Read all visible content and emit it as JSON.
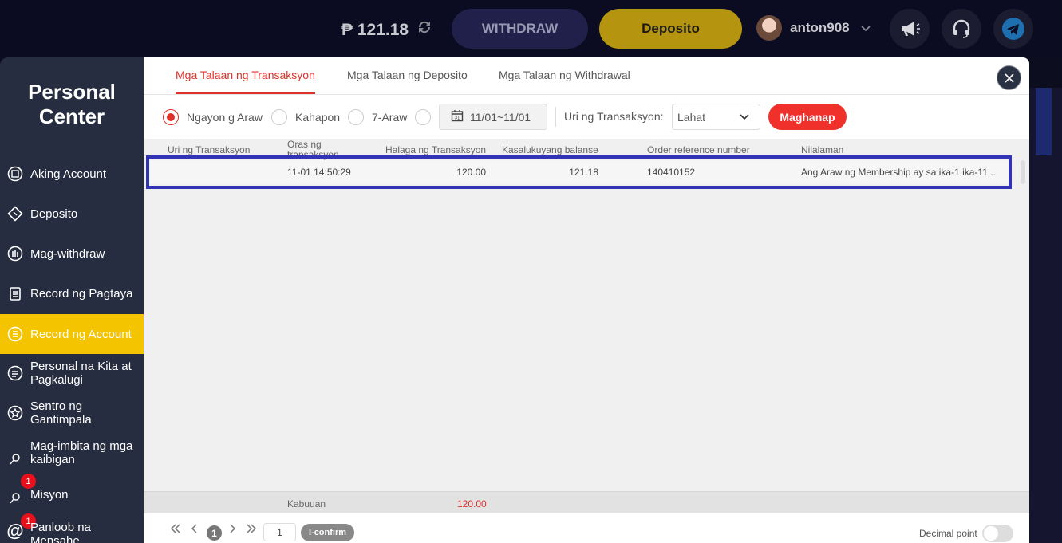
{
  "topbar": {
    "balance": "₱ 121.18",
    "withdraw_label": "WITHDRAW",
    "deposit_label": "Deposito",
    "username": "anton908",
    "icons": [
      "refresh-icon",
      "megaphone-icon",
      "headset-icon",
      "telegram-icon"
    ]
  },
  "sidebar": {
    "title": "Personal Center",
    "items": [
      {
        "label": "Aking Account",
        "icon": "account-icon"
      },
      {
        "label": "Deposito",
        "icon": "deposit-icon"
      },
      {
        "label": "Mag-withdraw",
        "icon": "withdraw-icon"
      },
      {
        "label": "Record ng Pagtaya",
        "icon": "clipboard-icon"
      },
      {
        "label": "Record ng Account",
        "icon": "list-icon",
        "active": true
      },
      {
        "label": "Personal na Kita at Pagkalugi",
        "icon": "report-icon"
      },
      {
        "label": "Sentro ng Gantimpala",
        "icon": "star-icon"
      },
      {
        "label": "Mag-imbita ng mga kaibigan",
        "icon": "invite-icon"
      },
      {
        "label": "Misyon",
        "icon": "mission-icon",
        "badge": "1"
      },
      {
        "label": "Panloob na Mensahe",
        "icon": "message-icon",
        "badge": "1"
      }
    ]
  },
  "tabs": [
    {
      "label": "Mga Talaan ng Transaksyon",
      "active": true
    },
    {
      "label": "Mga Talaan ng Deposito"
    },
    {
      "label": "Mga Talaan ng Withdrawal"
    }
  ],
  "filters": {
    "radios": [
      {
        "label": "Ngayon g Araw",
        "selected": true
      },
      {
        "label": "Kahapon"
      },
      {
        "label": "7-Araw"
      },
      {
        "label": ""
      }
    ],
    "date_range": "11/01~11/01",
    "type_label": "Uri ng Transaksyon:",
    "type_value": "Lahat",
    "search_label": "Maghanap"
  },
  "table": {
    "headers": [
      "Uri ng Transaksyon",
      "Oras ng transaksyon",
      "Halaga ng Transaksyon",
      "Kasalukuyang balanse",
      "Order reference number",
      "Nilalaman"
    ],
    "rows": [
      {
        "type": "",
        "time": "11-01 14:50:29",
        "amount": "120.00",
        "balance": "121.18",
        "order": "140410152",
        "content": "Ang Araw ng Membership ay sa ika-1 ika-11..."
      }
    ]
  },
  "totals": {
    "label": "Kabuuan",
    "amount": "120.00"
  },
  "pager": {
    "current_page": "1",
    "jump_value": "1",
    "confirm_label": "I-confirm",
    "decimal_label": "Decimal point"
  },
  "colors": {
    "accent": "#e0302a",
    "active_nav": "#f5c400",
    "highlight_border": "#3235b3"
  }
}
